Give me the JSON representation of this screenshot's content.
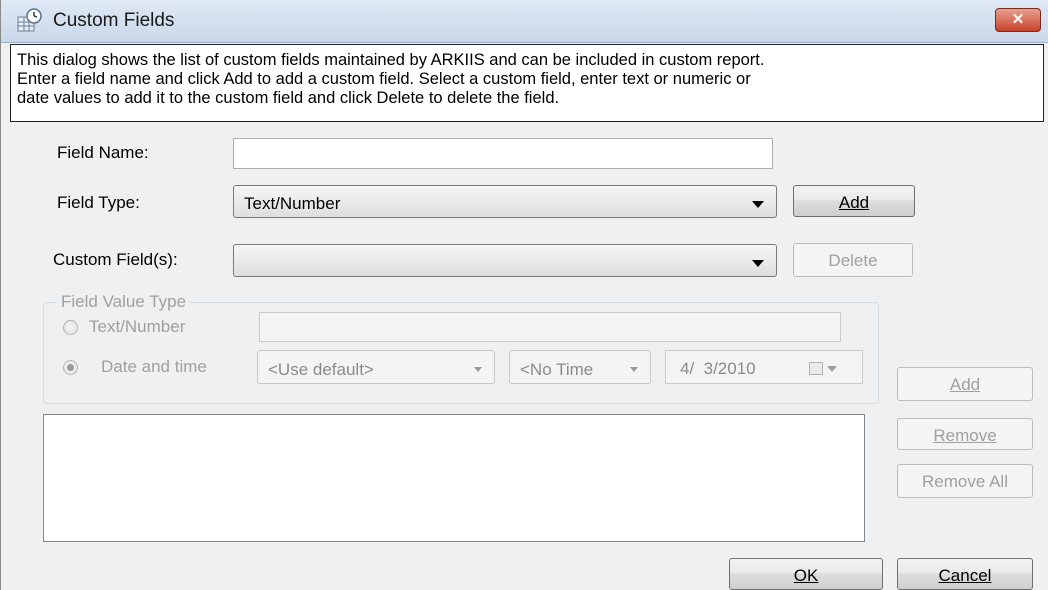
{
  "window": {
    "title": "Custom Fields",
    "close_glyph": "✕",
    "close_color": "#c8442c"
  },
  "description": {
    "lines": [
      "This dialog shows the list of custom fields maintained by ARKIIS and can be included in custom report.",
      "Enter a field name and click Add to add a custom field. Select a custom field, enter text or numeric or",
      "date values to add it to the custom field and click Delete to delete the field."
    ]
  },
  "form": {
    "field_name_label": "Field Name:",
    "field_name_value": "",
    "field_type_label": "Field Type:",
    "field_type_value": "Text/Number",
    "add_label": "Add",
    "custom_fields_label": "Custom Field(s):",
    "custom_fields_value": "",
    "delete_label": "Delete"
  },
  "value_group": {
    "legend": "Field Value Type",
    "text_number_label": "Text/Number",
    "text_number_value": "",
    "date_time_label": "Date and time",
    "date_format_value": "<Use default>",
    "time_value": "<No Time",
    "date_value": "4/  3/2010",
    "selected_option": "Date and time"
  },
  "side_buttons": {
    "add_label": "Add",
    "remove_label": "Remove",
    "remove_all_label": "Remove All"
  },
  "footer": {
    "ok_label": "OK",
    "cancel_label": "Cancel"
  }
}
